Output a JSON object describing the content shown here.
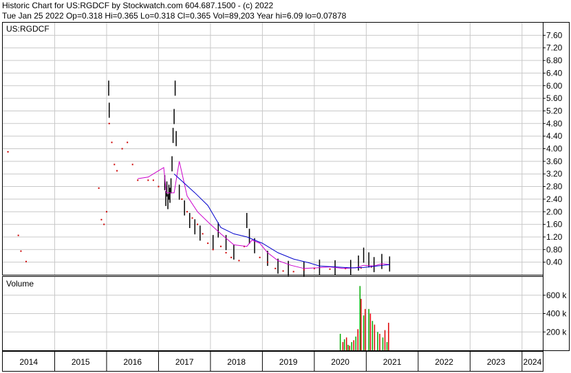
{
  "header": {
    "line1": "Historic Chart for US:RGDCF by Stockwatch.com 604.687.1500 - (c) 2022",
    "line2": "Tue Jan 25 2022   Op=0.318   Hi=0.365   Lo=0.318   Cl=0.365   Vol=89,203   Year hi=6.09   lo=0.07878"
  },
  "chart_data": [
    {
      "type": "line",
      "title": "US:RGDCF",
      "grid": true,
      "y_axis_side": "right",
      "ylim": [
        0,
        8.0
      ],
      "yticks": [
        "7.60",
        "7.20",
        "6.80",
        "6.40",
        "6.00",
        "5.60",
        "5.20",
        "4.80",
        "4.40",
        "4.00",
        "3.60",
        "3.20",
        "2.80",
        "2.40",
        "2.00",
        "1.60",
        "1.20",
        "0.80",
        "0.40"
      ],
      "xlim": [
        2014.0,
        2024.4
      ],
      "xticks": [
        "2014",
        "2015",
        "2016",
        "2017",
        "2018",
        "2019",
        "2020",
        "2021",
        "2022",
        "2023",
        "2024"
      ],
      "series": [
        {
          "role": "price-bars",
          "color": "#000000",
          "points": [
            [
              2016.04,
              5.9
            ],
            [
              2016.05,
              5.2
            ],
            [
              2017.12,
              2.9
            ],
            [
              2017.14,
              2.4
            ],
            [
              2017.16,
              2.7
            ],
            [
              2017.18,
              2.3
            ],
            [
              2017.2,
              2.6
            ],
            [
              2017.22,
              2.5
            ],
            [
              2017.24,
              2.8
            ],
            [
              2017.26,
              3.5
            ],
            [
              2017.28,
              4.4
            ],
            [
              2017.3,
              5.0
            ],
            [
              2017.32,
              5.9
            ],
            [
              2017.34,
              4.3
            ],
            [
              2017.4,
              2.6
            ],
            [
              2017.5,
              2.1
            ],
            [
              2017.6,
              1.7
            ],
            [
              2017.7,
              1.5
            ],
            [
              2017.8,
              1.3
            ],
            [
              2018.05,
              1.0
            ],
            [
              2018.15,
              1.4
            ],
            [
              2018.3,
              1.0
            ],
            [
              2018.45,
              0.7
            ],
            [
              2018.7,
              1.7
            ],
            [
              2018.75,
              1.2
            ],
            [
              2018.85,
              0.9
            ],
            [
              2019.1,
              0.5
            ],
            [
              2019.3,
              0.25
            ],
            [
              2019.5,
              0.18
            ],
            [
              2019.8,
              0.15
            ],
            [
              2020.1,
              0.22
            ],
            [
              2020.4,
              0.2
            ],
            [
              2020.7,
              0.21
            ],
            [
              2020.85,
              0.35
            ],
            [
              2020.95,
              0.6
            ],
            [
              2021.05,
              0.45
            ],
            [
              2021.15,
              0.3
            ],
            [
              2021.3,
              0.4
            ],
            [
              2021.45,
              0.32
            ]
          ]
        },
        {
          "role": "price-dots",
          "color": "#cc0000",
          "points": [
            [
              2014.1,
              3.9
            ],
            [
              2014.3,
              1.25
            ],
            [
              2014.35,
              0.75
            ],
            [
              2014.45,
              0.42
            ],
            [
              2015.85,
              2.75
            ],
            [
              2015.9,
              1.75
            ],
            [
              2015.95,
              1.6
            ],
            [
              2016.0,
              2.0
            ],
            [
              2016.05,
              4.8
            ],
            [
              2016.1,
              4.2
            ],
            [
              2016.15,
              3.5
            ],
            [
              2016.2,
              3.3
            ],
            [
              2016.3,
              4.0
            ],
            [
              2016.4,
              4.2
            ],
            [
              2016.5,
              3.5
            ],
            [
              2016.6,
              3.0
            ],
            [
              2016.8,
              3.0
            ],
            [
              2016.9,
              3.0
            ],
            [
              2017.0,
              2.8
            ],
            [
              2017.45,
              2.4
            ],
            [
              2017.55,
              2.0
            ],
            [
              2017.65,
              1.8
            ],
            [
              2017.75,
              1.6
            ],
            [
              2017.85,
              1.3
            ],
            [
              2017.95,
              1.0
            ],
            [
              2018.05,
              0.8
            ],
            [
              2018.2,
              0.9
            ],
            [
              2018.3,
              0.7
            ],
            [
              2018.4,
              0.55
            ],
            [
              2018.55,
              0.45
            ],
            [
              2018.65,
              0.9
            ],
            [
              2018.95,
              0.55
            ],
            [
              2019.1,
              0.4
            ],
            [
              2019.25,
              0.2
            ],
            [
              2019.4,
              0.12
            ],
            [
              2019.6,
              0.1
            ],
            [
              2019.8,
              0.16
            ],
            [
              2020.0,
              0.2
            ],
            [
              2020.3,
              0.18
            ],
            [
              2020.6,
              0.2
            ],
            [
              2020.9,
              0.22
            ],
            [
              2021.1,
              0.25
            ],
            [
              2021.3,
              0.3
            ]
          ]
        },
        {
          "role": "moving-average-short",
          "color": "#cc00cc",
          "points": [
            [
              2016.6,
              3.05
            ],
            [
              2016.8,
              3.1
            ],
            [
              2017.0,
              3.3
            ],
            [
              2017.1,
              3.4
            ],
            [
              2017.15,
              2.6
            ],
            [
              2017.3,
              2.6
            ],
            [
              2017.4,
              3.6
            ],
            [
              2017.55,
              2.5
            ],
            [
              2017.75,
              2.0
            ],
            [
              2018.0,
              1.6
            ],
            [
              2018.2,
              1.3
            ],
            [
              2018.45,
              0.95
            ],
            [
              2018.7,
              0.9
            ],
            [
              2018.8,
              1.1
            ],
            [
              2018.95,
              1.0
            ],
            [
              2019.1,
              0.7
            ],
            [
              2019.3,
              0.45
            ],
            [
              2019.55,
              0.3
            ],
            [
              2019.8,
              0.2
            ],
            [
              2020.05,
              0.22
            ],
            [
              2020.3,
              0.25
            ],
            [
              2020.55,
              0.2
            ],
            [
              2020.8,
              0.22
            ],
            [
              2020.95,
              0.3
            ],
            [
              2021.15,
              0.28
            ],
            [
              2021.3,
              0.35
            ],
            [
              2021.45,
              0.32
            ]
          ]
        },
        {
          "role": "moving-average-long",
          "color": "#0000cc",
          "points": [
            [
              2017.3,
              3.2
            ],
            [
              2017.5,
              2.9
            ],
            [
              2017.7,
              2.6
            ],
            [
              2017.95,
              2.2
            ],
            [
              2018.2,
              1.5
            ],
            [
              2018.45,
              1.3
            ],
            [
              2018.7,
              1.2
            ],
            [
              2019.0,
              1.0
            ],
            [
              2019.3,
              0.7
            ],
            [
              2019.6,
              0.5
            ],
            [
              2019.9,
              0.38
            ],
            [
              2020.1,
              0.28
            ],
            [
              2020.4,
              0.25
            ],
            [
              2020.7,
              0.22
            ],
            [
              2020.95,
              0.23
            ],
            [
              2021.2,
              0.28
            ],
            [
              2021.45,
              0.32
            ]
          ]
        }
      ]
    },
    {
      "type": "bar",
      "title": "Volume",
      "grid": true,
      "y_axis_side": "right",
      "ylim": [
        0,
        800000
      ],
      "yticks": [
        "600 k",
        "400 k",
        "200 k"
      ],
      "xlim": [
        2014.0,
        2024.4
      ],
      "series": [
        {
          "role": "up-volume",
          "color": "#00aa00",
          "bars": [
            [
              2020.5,
              180000
            ],
            [
              2020.58,
              120000
            ],
            [
              2020.65,
              60000
            ],
            [
              2020.72,
              90000
            ],
            [
              2020.8,
              150000
            ],
            [
              2020.88,
              700000
            ],
            [
              2020.95,
              380000
            ],
            [
              2021.05,
              450000
            ],
            [
              2021.12,
              320000
            ],
            [
              2021.22,
              200000
            ],
            [
              2021.32,
              140000
            ],
            [
              2021.4,
              90000
            ]
          ]
        },
        {
          "role": "down-volume",
          "color": "#dd0000",
          "bars": [
            [
              2020.55,
              90000
            ],
            [
              2020.62,
              140000
            ],
            [
              2020.68,
              50000
            ],
            [
              2020.76,
              110000
            ],
            [
              2020.84,
              230000
            ],
            [
              2020.9,
              560000
            ],
            [
              2020.98,
              450000
            ],
            [
              2021.08,
              400000
            ],
            [
              2021.16,
              280000
            ],
            [
              2021.26,
              180000
            ],
            [
              2021.36,
              220000
            ],
            [
              2021.43,
              300000
            ]
          ]
        }
      ]
    }
  ]
}
